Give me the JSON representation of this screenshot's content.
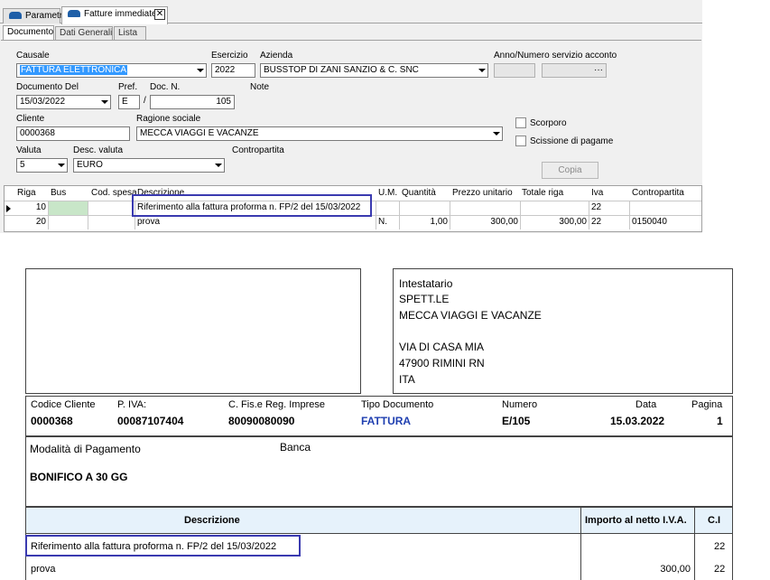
{
  "app": {
    "tabs": [
      {
        "label": "Parametri",
        "icon": "car-icon"
      },
      {
        "label": "Fatture immediate",
        "icon": "car-icon"
      }
    ],
    "close_glyph": "✕",
    "subtabs": [
      "Documento",
      "Dati Generali",
      "Lista"
    ],
    "form": {
      "causale_label": "Causale",
      "causale_value": "FATTURA ELETTRONICA",
      "esercizio_label": "Esercizio",
      "esercizio_value": "2022",
      "azienda_label": "Azienda",
      "azienda_value": "BUSSTOP DI ZANI SANZIO & C. SNC",
      "anno_label": "Anno/Numero servizio acconto",
      "anno_btn": "···",
      "docdel_label": "Documento Del",
      "docdel_value": "15/03/2022",
      "pref_label": "Pref.",
      "pref_value": "E",
      "slash": "/",
      "docn_label": "Doc. N.",
      "docn_value": "105",
      "note_label": "Note",
      "cliente_label": "Cliente",
      "cliente_value": "0000368",
      "ragione_label": "Ragione sociale",
      "ragione_value": "MECCA VIAGGI E VACANZE",
      "scorporo_label": "Scorporo",
      "scissione_label": "Scissione di pagame",
      "valuta_label": "Valuta",
      "valuta_value": "5",
      "descval_label": "Desc. valuta",
      "descval_value": "EURO",
      "contropartita_label": "Contropartita",
      "copia_label": "Copia"
    },
    "grid": {
      "headers": [
        "Riga",
        "Bus",
        "Cod. spesa",
        "Descrizione",
        "U.M.",
        "Quantità",
        "Prezzo unitario",
        "Totale riga",
        "Iva",
        "Contropartita"
      ],
      "rows": [
        {
          "riga": "10",
          "bus": "",
          "cod": "",
          "desc": "Riferimento alla fattura proforma n. FP/2 del 15/03/2022",
          "um": "",
          "qta": "",
          "prezzo": "",
          "totale": "",
          "iva": "22",
          "contro": ""
        },
        {
          "riga": "20",
          "bus": "",
          "cod": "",
          "desc": "prova",
          "um": "N.",
          "qta": "1,00",
          "prezzo": "300,00",
          "totale": "300,00",
          "iva": "22",
          "contro": "0150040"
        }
      ]
    }
  },
  "document": {
    "intestatario": {
      "label": "Intestatario",
      "lines": [
        "SPETT.LE",
        "MECCA VIAGGI E VACANZE",
        "",
        "VIA DI CASA MIA",
        "47900 RIMINI RN",
        "ITA"
      ]
    },
    "header": {
      "codice_cliente_label": "Codice Cliente",
      "codice_cliente": "0000368",
      "piva_label": "P. IVA:",
      "piva": "00087107404",
      "cf_label": "C. Fis.e Reg. Imprese",
      "cf": "80090080090",
      "tipo_label": "Tipo Documento",
      "tipo": "FATTURA",
      "numero_label": "Numero",
      "numero": "E/105",
      "data_label": "Data",
      "data": "15.03.2022",
      "pagina_label": "Pagina",
      "pagina": "1"
    },
    "pagamento": {
      "label": "Modalità di Pagamento",
      "banca_label": "Banca",
      "value": "BONIFICO A 30 GG"
    },
    "table": {
      "col_descrizione": "Descrizione",
      "col_importo": "Importo al netto I.V.A.",
      "col_ci": "C.I",
      "rows": [
        {
          "desc": "Riferimento alla fattura proforma n. FP/2 del 15/03/2022",
          "importo": "",
          "ci": "22"
        },
        {
          "desc": "prova",
          "importo": "300,00",
          "ci": "22"
        }
      ]
    }
  },
  "colors": {
    "highlight": "#3a3ab0",
    "tipo_blue": "#1f3fb0",
    "header_bg": "#e6f2fb",
    "selection": "#3399ff"
  }
}
